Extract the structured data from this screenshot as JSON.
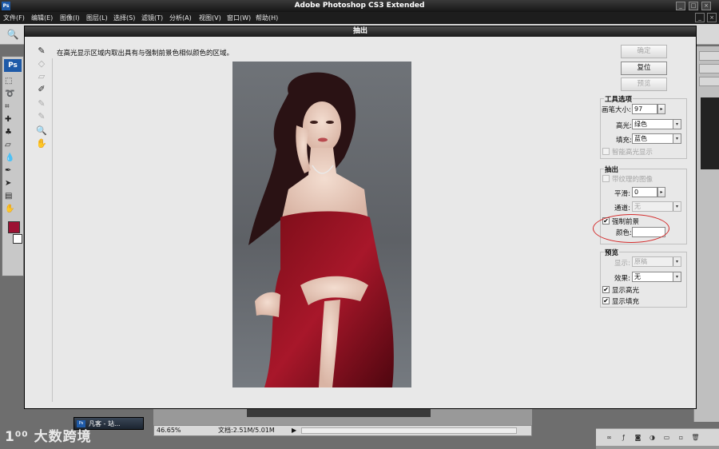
{
  "app": {
    "ps_badge": "Ps",
    "title": "Adobe Photoshop CS3 Extended",
    "window_buttons": [
      "_",
      "□",
      "×"
    ],
    "menu": [
      "文件(F)",
      "编辑(E)",
      "图像(I)",
      "图层(L)",
      "选择(S)",
      "滤镜(T)",
      "分析(A)",
      "视图(V)",
      "窗口(W)",
      "帮助(H)"
    ],
    "menu_right_buttons": [
      "_",
      "×"
    ],
    "toolbox_logo": "Ps"
  },
  "dialog": {
    "title": "抽出",
    "instruction": "在高光显示区域内取出具有与强制前景色相似颜色的区域。",
    "buttons": {
      "ok": "确定",
      "reset": "复位",
      "preview": "预览"
    },
    "tool_options": {
      "title": "工具选项",
      "brush_size_label": "画笔大小:",
      "brush_size_value": "97",
      "highlight_label": "高光:",
      "highlight_value": "绿色",
      "fill_label": "填充:",
      "fill_value": "蓝色",
      "smart_highlight_label": "智能高光显示"
    },
    "extraction": {
      "title": "抽出",
      "textured_image_label": "带纹理的图像",
      "smooth_label": "平滑:",
      "smooth_value": "0",
      "channel_label": "通道:",
      "channel_value": "无",
      "force_foreground_label": "强制前景",
      "color_label": "颜色:"
    },
    "preview_group": {
      "title": "预览",
      "show_label": "显示:",
      "show_value": "原稿",
      "effect_label": "效果:",
      "effect_value": "无",
      "show_highlight_label": "显示高光",
      "show_fill_label": "显示填充"
    },
    "colors": {
      "force_foreground_color": "#ffffff",
      "annotation": "#d32b2b"
    }
  },
  "document": {
    "zoom": "46.65%",
    "file_size": "文档:2.51M/5.01M"
  },
  "taskbar": {
    "item_label": "凡客 - 站...",
    "badge": "Ps"
  },
  "watermark": "1⁰⁰ 大数跨境",
  "icons": {
    "arrow_right": "▶",
    "check": "✔",
    "spin": "▸",
    "dropdown": "▾"
  }
}
